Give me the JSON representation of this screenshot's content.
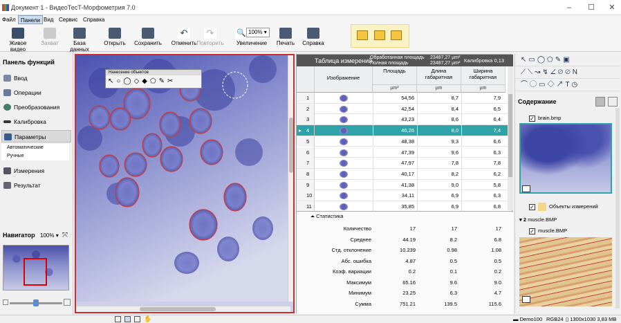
{
  "window": {
    "title": "Документ 1 - ВидеоТесТ-Морфометрия 7.0"
  },
  "menu": [
    "Файл",
    "Панели",
    "Вид",
    "Сервис",
    "Справка"
  ],
  "toolbar": {
    "live_video": "Живое видео",
    "capture": "Захват",
    "database": "База данных",
    "open": "Открыть",
    "save": "Сохранить",
    "undo": "Отменить",
    "redo": "Повторить",
    "zoom": "Увеличение",
    "zoom_value": "100%",
    "print": "Печать",
    "help": "Справка"
  },
  "left_panel": {
    "title": "Панель функций",
    "items": [
      "Ввод",
      "Операции",
      "Преобразования",
      "Калибровка",
      "Параметры",
      "Измерения",
      "Результат"
    ],
    "sub_items": [
      "Автоматические",
      "Ручные"
    ]
  },
  "navigator": {
    "title": "Навигатор",
    "zoom": "100%"
  },
  "floating_toolbar": {
    "title": "Нанесение объектов"
  },
  "measure_table": {
    "title": "Таблица измерений",
    "processed_area_label": "Обработанная площадь",
    "processed_area": "23487,27 µm²",
    "total_area_label": "Полная площадь",
    "total_area": "23487,27 µm²",
    "calibration_label": "Калибровка",
    "calibration_value": "0,13",
    "columns": [
      "Изображение",
      "Площадь",
      "Длина габаритная",
      "Ширина габаритная"
    ],
    "units": [
      "µm²",
      "µm",
      "µm"
    ],
    "rows": [
      {
        "n": "1",
        "area": "54,56",
        "len": "8,7",
        "wid": "7,9"
      },
      {
        "n": "2",
        "area": "42,54",
        "len": "8,4",
        "wid": "6,5"
      },
      {
        "n": "3",
        "area": "43,23",
        "len": "8,6",
        "wid": "6,4"
      },
      {
        "n": "4",
        "area": "46,26",
        "len": "8,0",
        "wid": "7,4"
      },
      {
        "n": "5",
        "area": "48,38",
        "len": "9,3",
        "wid": "6,6"
      },
      {
        "n": "6",
        "area": "47,39",
        "len": "9,6",
        "wid": "6,3"
      },
      {
        "n": "7",
        "area": "47,97",
        "len": "7,8",
        "wid": "7,8"
      },
      {
        "n": "8",
        "area": "40,17",
        "len": "8,2",
        "wid": "6,2"
      },
      {
        "n": "9",
        "area": "41,38",
        "len": "9,0",
        "wid": "5,8"
      },
      {
        "n": "10",
        "area": "34,11",
        "len": "6,9",
        "wid": "6,3"
      },
      {
        "n": "11",
        "area": "35,85",
        "len": "6,9",
        "wid": "6,8"
      }
    ],
    "selected_row": 3
  },
  "stats": {
    "title": "Статистика",
    "rows": [
      {
        "label": "Количество",
        "a": "17",
        "b": "17",
        "c": "17"
      },
      {
        "label": "Среднее",
        "a": "44.19",
        "b": "8.2",
        "c": "6.8"
      },
      {
        "label": "Стд. отклонение",
        "a": "10.239",
        "b": "0.98",
        "c": "1.08"
      },
      {
        "label": "Абс. ошибка",
        "a": "4.87",
        "b": "0.5",
        "c": "0.5"
      },
      {
        "label": "Коэф. вариации",
        "a": "0.2",
        "b": "0.1",
        "c": "0.2"
      },
      {
        "label": "Максимум",
        "a": "65.16",
        "b": "9.6",
        "c": "9.0"
      },
      {
        "label": "Минимум",
        "a": "23.25",
        "b": "6.3",
        "c": "4.7"
      },
      {
        "label": "Сумма",
        "a": "751.21",
        "b": "139.5",
        "c": "115.6"
      }
    ]
  },
  "right_panel": {
    "title": "Содержание",
    "layer1_name": "brain.bmp",
    "layer1_objects": "Объекты измерений",
    "group_num": "2",
    "group_name": "muscle.BMP",
    "layer2_name": "muscle.BMP"
  },
  "statusbar": {
    "user": "Demo100",
    "mode": "RGB24",
    "size": "1300x1030 3,83 MB"
  }
}
